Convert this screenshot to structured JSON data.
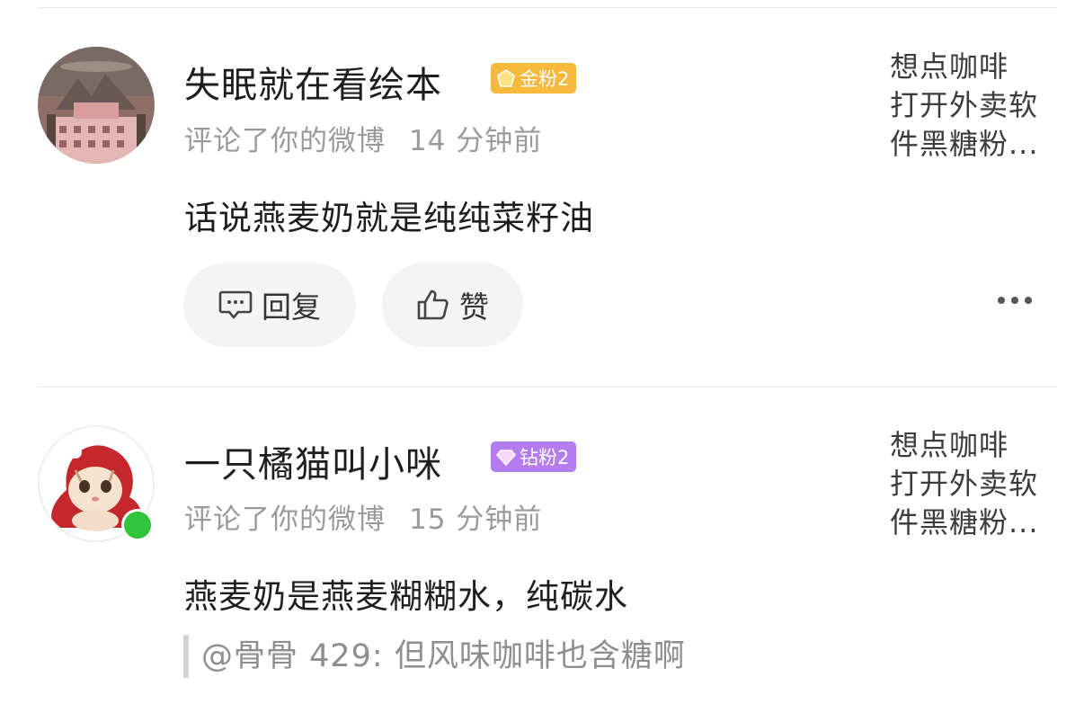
{
  "comments": [
    {
      "username": "失眠就在看绘本",
      "badge": "金粉2",
      "badge_color": "#f6b93b",
      "action": "评论了你的微博",
      "time": "14 分钟前",
      "text": "话说燕麦奶就是纯纯菜籽油",
      "preview": [
        "想点咖啡",
        "打开外卖软",
        "件黑糖粉..."
      ],
      "actions": {
        "reply": "回复",
        "like": "赞"
      }
    },
    {
      "username": "一只橘猫叫小咪",
      "badge": "钻粉2",
      "badge_color": "#b57bf0",
      "action": "评论了你的微博",
      "time": "15 分钟前",
      "text": "燕麦奶是燕麦糊糊水，纯碳水",
      "quote": "@骨骨 429: 但风味咖啡也含糖啊",
      "preview": [
        "想点咖啡",
        "打开外卖软",
        "件黑糖粉..."
      ]
    }
  ]
}
